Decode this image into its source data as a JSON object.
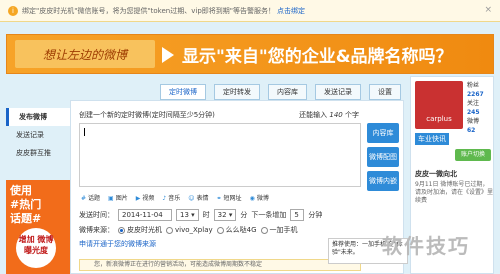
{
  "notice": {
    "icon": "info-icon",
    "text": "绑定\"皮皮时光机\"微信账号，将为您提供\"token过期、vip即将到期\"等告警服务！",
    "link": "点击绑定",
    "close": "×"
  },
  "banner": {
    "left_text": "想让左边的微博",
    "title": "显示\"来自\"您的企业&品牌名称吗？"
  },
  "tabs": [
    "定时微博",
    "定时转发",
    "内容库",
    "发送记录",
    "设置"
  ],
  "sidebar": {
    "items": [
      "发布微博",
      "发送记录",
      "皮皮群互推"
    ]
  },
  "promo": {
    "line1": "使用",
    "line2": "#热门",
    "line3": "话题#",
    "bubble": "增加 微博 曝光度"
  },
  "composer": {
    "hint": "创建一个新的定时微博(定时间隔至少5分钟)",
    "remain_prefix": "还能输入",
    "remain_count": "140",
    "remain_suffix": "个字",
    "buttons": [
      "内容库",
      "微博配图",
      "微博内嵌"
    ]
  },
  "toolbar": {
    "items": [
      "话题",
      "图片",
      "视频",
      "音乐",
      "表情",
      "短网址",
      "微博"
    ]
  },
  "schedule": {
    "label": "发送时间：",
    "date": "2014-11-04",
    "hour": "13",
    "hour_unit": "时",
    "minute": "32",
    "minute_unit": "分",
    "interval_label": "下一条增加",
    "interval": "5",
    "interval_unit": "分钟"
  },
  "source": {
    "label": "微博来源：",
    "options": [
      "皮皮时光机",
      "vivo_Xplay",
      "么么哒4G",
      "一加手机"
    ],
    "apply_link": "申请开通于您的微博来源"
  },
  "warning": "您，新浪微博正在进行的营销活动，可能造成微博周期数不稳定",
  "tooltip": "推荐使用：一加手机 在\"体验\"未来。",
  "rpanel": {
    "stats": [
      {
        "label": "粉丝",
        "value": "2267"
      },
      {
        "label": "关注",
        "value": "245"
      },
      {
        "label": "微博",
        "value": "62"
      }
    ],
    "tag": "车业快讯",
    "switch": "账户切换",
    "username": "皮皮一微向北",
    "info": "9月11日 微博账号已过期，请及时加油，请在《设置》里续费"
  },
  "watermark": "软件技巧"
}
